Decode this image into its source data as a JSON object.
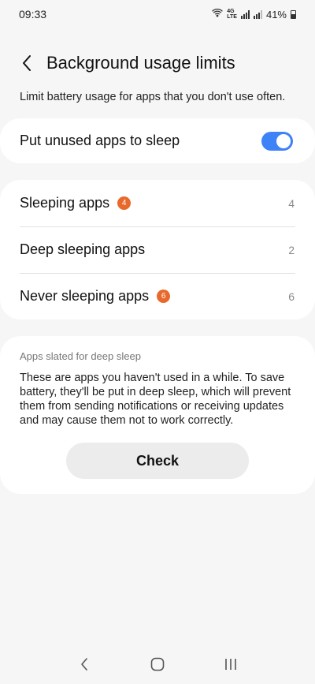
{
  "status_bar": {
    "time": "09:33",
    "network_top": "4G",
    "network_bottom": "LTE",
    "battery": "41%"
  },
  "header": {
    "title": "Background usage limits"
  },
  "description": "Limit battery usage for apps that you don't use often.",
  "sleep_toggle": {
    "label": "Put unused apps to sleep",
    "enabled": true
  },
  "app_lists": [
    {
      "label": "Sleeping apps",
      "badge": "4",
      "count": "4"
    },
    {
      "label": "Deep sleeping apps",
      "badge": "",
      "count": "2"
    },
    {
      "label": "Never sleeping apps",
      "badge": "6",
      "count": "6"
    }
  ],
  "deep_sleep_info": {
    "heading": "Apps slated for deep sleep",
    "body": "These are apps you haven't used in a while. To save battery, they'll be put in deep sleep, which will prevent them from sending notifications or receiving updates and may cause them not to work correctly.",
    "button_label": "Check"
  },
  "colors": {
    "accent": "#3e82f7",
    "badge": "#e8692c",
    "background": "#f6f6f6",
    "card": "#ffffff"
  },
  "icons": [
    "hotspot-icon",
    "signal-icon",
    "battery-icon",
    "back-arrow-icon",
    "nav-back-icon",
    "nav-home-icon",
    "nav-recents-icon"
  ]
}
